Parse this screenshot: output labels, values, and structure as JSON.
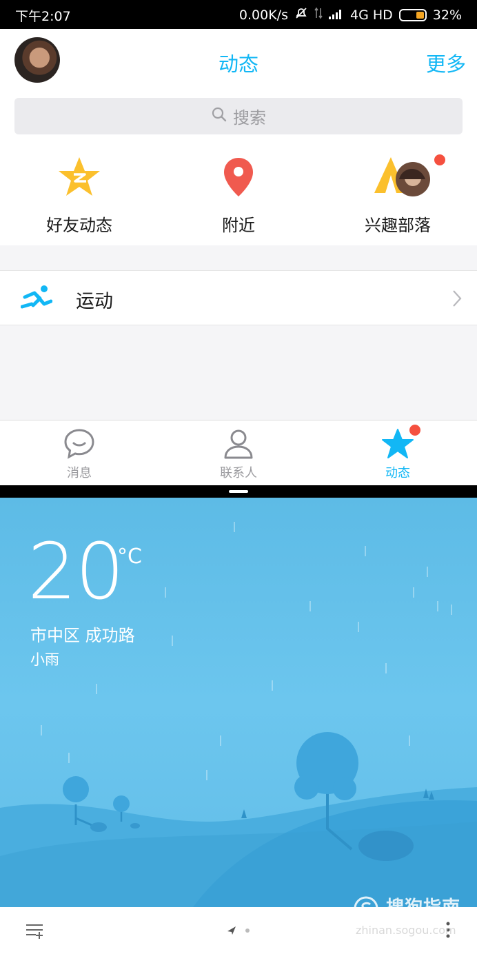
{
  "status_bar": {
    "time": "下午2:07",
    "speed": "0.00K/s",
    "network": "4G HD",
    "battery": "32%"
  },
  "qq": {
    "title": "动态",
    "more": "更多",
    "search_placeholder": "搜索",
    "shortcuts": [
      {
        "label": "好友动态",
        "icon": "qzone-star-icon"
      },
      {
        "label": "附近",
        "icon": "location-pin-icon"
      },
      {
        "label": "兴趣部落",
        "icon": "tribe-tent-icon"
      }
    ],
    "sport": {
      "label": "运动",
      "icon": "sport-runner-icon"
    },
    "tabs": [
      {
        "label": "消息",
        "icon": "message-bubble-icon",
        "active": false
      },
      {
        "label": "联系人",
        "icon": "contacts-person-icon",
        "active": false
      },
      {
        "label": "动态",
        "icon": "star-icon",
        "active": true
      }
    ],
    "accent_color": "#12b7f5",
    "badge_color": "#f5503f"
  },
  "weather": {
    "temperature": "20",
    "unit": "°C",
    "location": "市中区  成功路",
    "condition": "小雨",
    "bg_color": "#62bde8"
  },
  "watermark": {
    "text": "搜狗指南",
    "sub": "zhinan.sogou.com"
  }
}
